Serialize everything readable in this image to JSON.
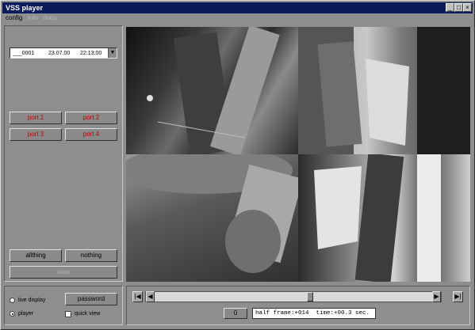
{
  "window": {
    "title": "VSS player",
    "controls": {
      "minimize": "_",
      "maximize": "□",
      "close": "×"
    }
  },
  "menu": [
    {
      "label": "config",
      "active": true
    },
    {
      "label": "info",
      "active": false
    },
    {
      "label": "docu",
      "active": false
    }
  ],
  "recording_select": {
    "id": "___0001",
    "date": "23.07.00",
    "time": "22:13:00",
    "arrow": "▼"
  },
  "ports": [
    {
      "label": "port 1"
    },
    {
      "label": "port 2"
    },
    {
      "label": "port 3"
    },
    {
      "label": "port 4"
    }
  ],
  "actions": {
    "allthing": "allthing",
    "nothing": "nothing",
    "view": "view"
  },
  "mode": {
    "live_display": "live display",
    "player": "player",
    "selected": "player"
  },
  "password_button": "password",
  "quick_view": {
    "label": "quick view",
    "checked": false
  },
  "transport": {
    "first": "|◀",
    "prev": "◀",
    "next": "▶",
    "last": "▶|",
    "position_fraction": 0.56
  },
  "frame_counter": "0",
  "status_text": "half frame:+014  time:+00.3 sec.",
  "colors": {
    "title_bar": "#0a1b5b",
    "port_text": "#c00000",
    "panel": "#8e8e8e"
  },
  "cameras": [
    {
      "id": "cam-1"
    },
    {
      "id": "cam-2"
    },
    {
      "id": "cam-3"
    },
    {
      "id": "cam-4"
    }
  ]
}
